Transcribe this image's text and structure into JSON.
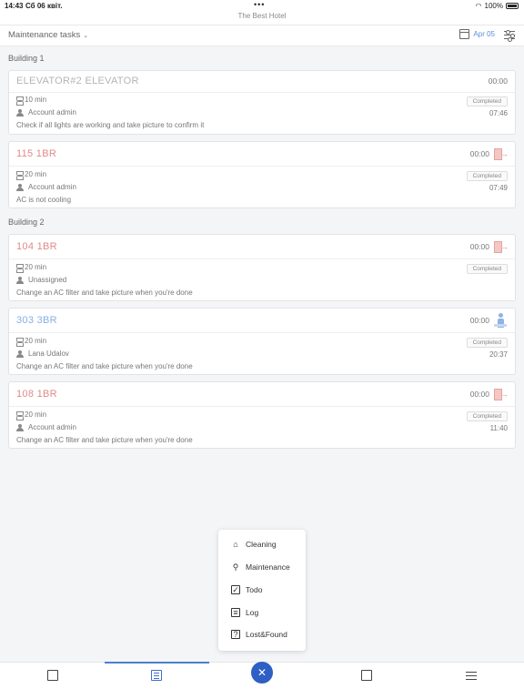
{
  "status_bar": {
    "time": "14:43",
    "date": "Сб 06 квіт.",
    "dots": "•••",
    "battery": "100%"
  },
  "app": {
    "title": "The Best Hotel"
  },
  "toolbar": {
    "title": "Maintenance tasks",
    "date": "Apr 05"
  },
  "buildings": [
    {
      "name": "Building 1"
    },
    {
      "name": "Building 2"
    }
  ],
  "tasks": [
    {
      "name": "ELEVATOR#2 ELEVATOR",
      "elapsed": "00:00",
      "duration": "10 min",
      "assignee": "Account admin",
      "status": "Completed",
      "time": "07:46",
      "description": "Check if all lights are working and take picture to confirm it"
    },
    {
      "name": "115 1BR",
      "elapsed": "00:00",
      "duration": "20 min",
      "assignee": "Account admin",
      "status": "Completed",
      "time": "07:49",
      "description": "AC is not cooling"
    },
    {
      "name": "104 1BR",
      "elapsed": "00:00",
      "duration": "20 min",
      "assignee": "Unassigned",
      "status": "Completed",
      "time": "",
      "description": "Change an AC filter and take picture when you're done"
    },
    {
      "name": "303 3BR",
      "elapsed": "00:00",
      "duration": "20 min",
      "assignee": "Lana Udalov",
      "status": "Completed",
      "time": "20:37",
      "description": "Change an AC filter and take picture when you're done"
    },
    {
      "name": "108 1BR",
      "elapsed": "00:00",
      "duration": "20 min",
      "assignee": "Account admin",
      "status": "Completed",
      "time": "11:40",
      "description": "Change an AC filter and take picture when you're done"
    }
  ],
  "menu": {
    "items": [
      {
        "label": "Cleaning",
        "icon": "brush-icon"
      },
      {
        "label": "Maintenance",
        "icon": "wrench-icon"
      },
      {
        "label": "Todo",
        "icon": "checkbox-icon"
      },
      {
        "label": "Log",
        "icon": "log-icon"
      },
      {
        "label": "Lost&Found",
        "icon": "question-icon"
      }
    ]
  },
  "colors": {
    "accent": "#2d5fc4",
    "red_room": "#e08a86",
    "blue_room": "#87aee3"
  }
}
